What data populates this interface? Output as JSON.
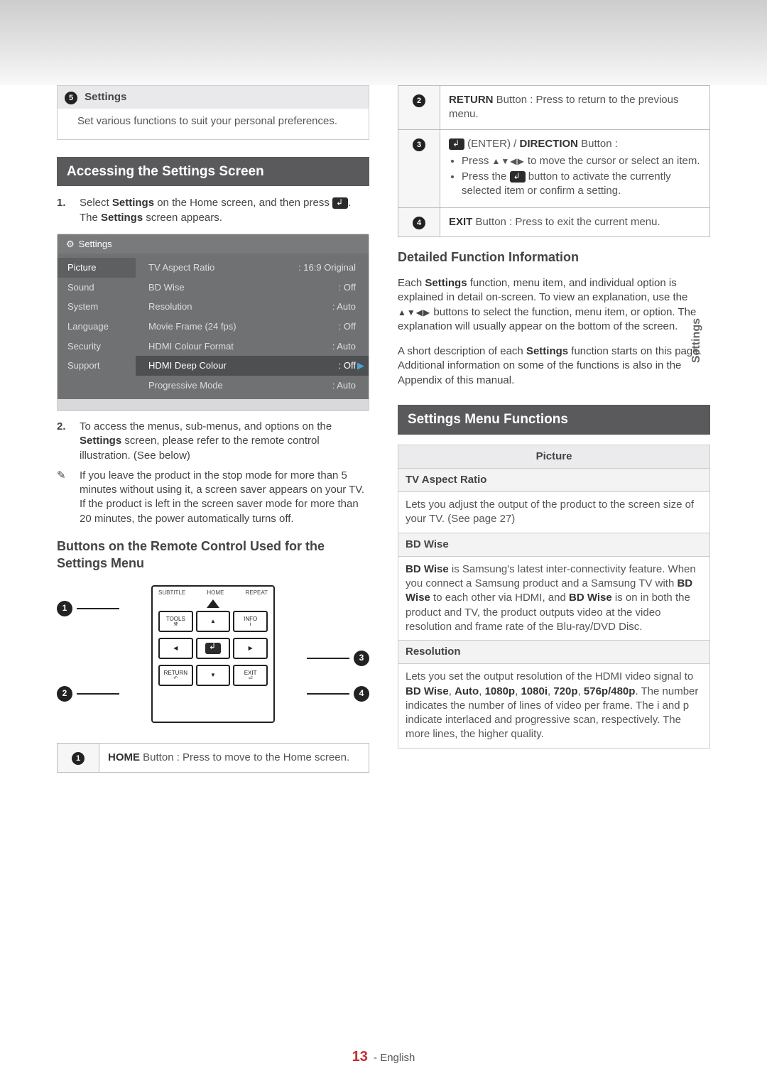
{
  "sideTab": "Settings",
  "callout5": {
    "num": "5",
    "title": "Settings",
    "body": "Set various functions to suit your personal preferences."
  },
  "accessHeading": "Accessing the Settings Screen",
  "step1": {
    "num": "1.",
    "a": "Select ",
    "b": "Settings",
    "c": " on the Home screen, and then press ",
    "d": ". The ",
    "e": "Settings",
    "f": " screen appears."
  },
  "osd": {
    "title": "Settings",
    "left": [
      "Picture",
      "Sound",
      "System",
      "Language",
      "Security",
      "Support"
    ],
    "rows": [
      {
        "k": "TV Aspect Ratio",
        "v": ": 16:9 Original"
      },
      {
        "k": "BD Wise",
        "v": ": Off"
      },
      {
        "k": "Resolution",
        "v": ": Auto"
      },
      {
        "k": "Movie Frame (24 fps)",
        "v": ": Off"
      },
      {
        "k": "HDMI Colour Format",
        "v": ": Auto"
      },
      {
        "k": "HDMI Deep Colour",
        "v": ": Off"
      },
      {
        "k": "Progressive Mode",
        "v": ": Auto"
      }
    ]
  },
  "step2": {
    "num": "2.",
    "a": "To access the menus, sub-menus, and options on the ",
    "b": "Settings",
    "c": " screen, please refer to the remote control illustration. (See below)"
  },
  "note": {
    "mark": "✎",
    "text": "If you leave the product in the stop mode for more than 5 minutes without using it, a screen saver appears on your TV. If the product is left in the screen saver mode for more than 20 minutes, the power automatically turns off."
  },
  "buttonsHeading": "Buttons on the Remote Control Used for the Settings Menu",
  "remoteLabels": {
    "subtitle": "SUBTITLE",
    "home": "HOME",
    "repeat": "REPEAT",
    "tools": "TOOLS",
    "info": "INFO",
    "return": "RETURN",
    "exit": "EXIT"
  },
  "pins": {
    "p1": "1",
    "p2": "2",
    "p3": "3",
    "p4": "4"
  },
  "legend": {
    "r1_n": "1",
    "r1_a": "HOME",
    "r1_b": " Button : Press to move to the Home screen.",
    "r2_n": "2",
    "r2_a": "RETURN",
    "r2_b": " Button : Press to return to the previous menu.",
    "r3_n": "3",
    "r3_a": " (ENTER) / ",
    "r3_b": "DIRECTION",
    "r3_c": " Button :",
    "r3_li1_a": "Press ",
    "r3_li1_b": " to move the cursor or select an item.",
    "r3_li2_a": "Press the ",
    "r3_li2_b": " button to activate the currently selected item or confirm a setting.",
    "r4_n": "4",
    "r4_a": "EXIT",
    "r4_b": " Button : Press to exit the current menu."
  },
  "detailHeading": "Detailed Function Information",
  "detailP1_a": "Each ",
  "detailP1_b": "Settings",
  "detailP1_c": " function, menu item, and individual option is explained in detail on-screen. To view an explanation, use the ",
  "detailP1_d": " buttons to select the function, menu item, or option. The explanation will usually appear on the bottom of the screen.",
  "detailP2_a": "A short description of each ",
  "detailP2_b": "Settings",
  "detailP2_c": " function starts on this page. Additional information on some of the functions is also in the Appendix of this manual.",
  "menuFuncHeading": "Settings Menu Functions",
  "pic": {
    "section": "Picture",
    "i1_t": "TV Aspect Ratio",
    "i1_b": "Lets you adjust the output of the product to the screen size of your TV. (See page 27)",
    "i2_t": "BD Wise",
    "i2_a": "BD Wise",
    "i2_b": " is Samsung's latest inter-connectivity feature. When you connect a Samsung product and a Samsung TV with ",
    "i2_c": "BD Wise",
    "i2_d": " to each other via HDMI, and ",
    "i2_e": "BD Wise",
    "i2_f": " is on in both the product and TV, the product outputs video at the video resolution and frame rate of the Blu-ray/DVD Disc.",
    "i3_t": "Resolution",
    "i3_a": "Lets you set the output resolution of the HDMI video signal to ",
    "i3_b": "BD Wise",
    "i3_c": ", ",
    "i3_d": "Auto",
    "i3_e": ", ",
    "i3_f": "1080p",
    "i3_g": ", ",
    "i3_h": "1080i",
    "i3_i": ", ",
    "i3_j": "720p",
    "i3_k": ", ",
    "i3_l": "576p/480p",
    "i3_m": ". The number indicates the number of lines of video per frame. The i and p indicate interlaced and progressive scan, respectively. The more lines, the higher quality."
  },
  "footer": {
    "page": "13",
    "lang": "- English"
  }
}
